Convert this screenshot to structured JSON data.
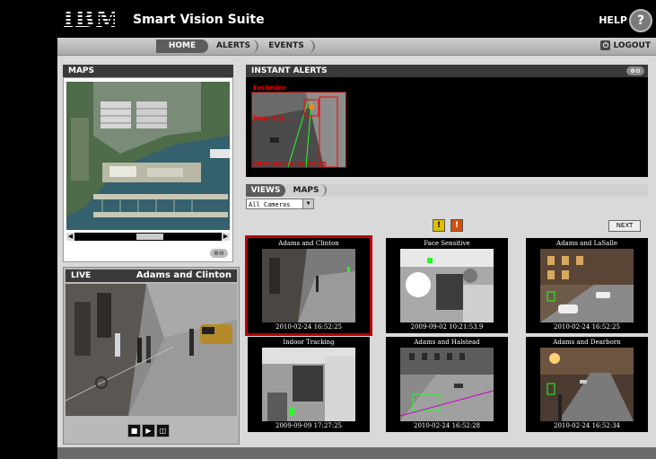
{
  "header": {
    "logo_text": "IBM",
    "app_title": "Smart Vision Suite",
    "help_label": "HELP",
    "help_icon": "?"
  },
  "nav": {
    "tabs": [
      {
        "label": "HOME"
      },
      {
        "label": "ALERTS"
      },
      {
        "label": "EVENTS"
      }
    ],
    "logout_label": "LOGOUT"
  },
  "maps_panel": {
    "title": "MAPS"
  },
  "live_panel": {
    "title": "LIVE",
    "camera_name": "Adams and Clinton"
  },
  "alerts_panel": {
    "title": "INSTANT ALERTS",
    "alert_label": "Exclusion",
    "alert_sub": "Main Ent...",
    "alert_time": "2010-02-24 16:52:25"
  },
  "views": {
    "tabs": [
      {
        "label": "VIEWS"
      },
      {
        "label": "MAPS"
      }
    ],
    "camera_select": "All Cameras",
    "next_label": "NEXT"
  },
  "tiles": [
    {
      "title": "Adams and Clinton",
      "time": "2010-02-24 16:52:25"
    },
    {
      "title": "Face Sensitive",
      "time": "2009-09-02 10:21:53.9"
    },
    {
      "title": "Adams and LaSalle",
      "time": "2010-02-24 16:52:25"
    },
    {
      "title": "Indoor Tracking",
      "time": "2009-09-09 17:27:25"
    },
    {
      "title": "Adams and Halstead",
      "time": "2010-02-24 16:52:28"
    },
    {
      "title": "Adams and Dearborn",
      "time": "2010-02-24 16:52:34"
    }
  ],
  "colors": {
    "alert_red": "#cc0000",
    "header_black": "#000000",
    "panel_header": "#3a3a3a"
  }
}
